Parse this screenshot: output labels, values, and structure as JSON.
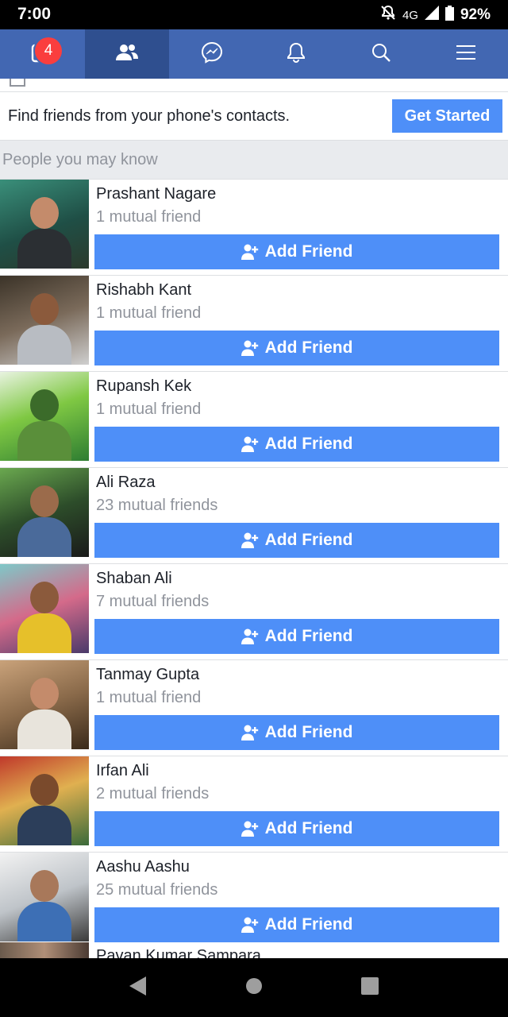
{
  "status_bar": {
    "time": "7:00",
    "network": "4G",
    "battery": "92%"
  },
  "nav": {
    "items": [
      {
        "name": "news-feed",
        "icon": "news-feed-icon",
        "badge": "4",
        "active": false
      },
      {
        "name": "friends",
        "icon": "friends-icon",
        "active": true
      },
      {
        "name": "messenger",
        "icon": "messenger-icon",
        "active": false
      },
      {
        "name": "notifications",
        "icon": "bell-icon",
        "active": false
      },
      {
        "name": "search",
        "icon": "search-icon",
        "active": false
      },
      {
        "name": "menu",
        "icon": "hamburger-icon",
        "active": false
      }
    ]
  },
  "contacts": {
    "text": "Find friends from your phone's contacts.",
    "button": "Get Started"
  },
  "section_title": "People you may know",
  "add_friend_label": "Add Friend",
  "people": [
    {
      "name": "Prashant Nagare",
      "mutual": "1 mutual friend"
    },
    {
      "name": "Rishabh Kant",
      "mutual": "1 mutual friend"
    },
    {
      "name": "Rupansh Kek",
      "mutual": "1 mutual friend"
    },
    {
      "name": "Ali Raza",
      "mutual": "23 mutual friends"
    },
    {
      "name": "Shaban Ali",
      "mutual": "7 mutual friends"
    },
    {
      "name": "Tanmay Gupta",
      "mutual": "1 mutual friend"
    },
    {
      "name": "Irfan Ali",
      "mutual": "2 mutual friends"
    },
    {
      "name": "Aashu Aashu",
      "mutual": "25 mutual friends"
    }
  ],
  "partial_person": {
    "name": "Pavan Kumar Sampara"
  },
  "colors": {
    "nav_bg": "#4267b2",
    "nav_active": "#2f4f8f",
    "button_blue": "#4e8ff8",
    "badge_red": "#fa3e3e"
  }
}
